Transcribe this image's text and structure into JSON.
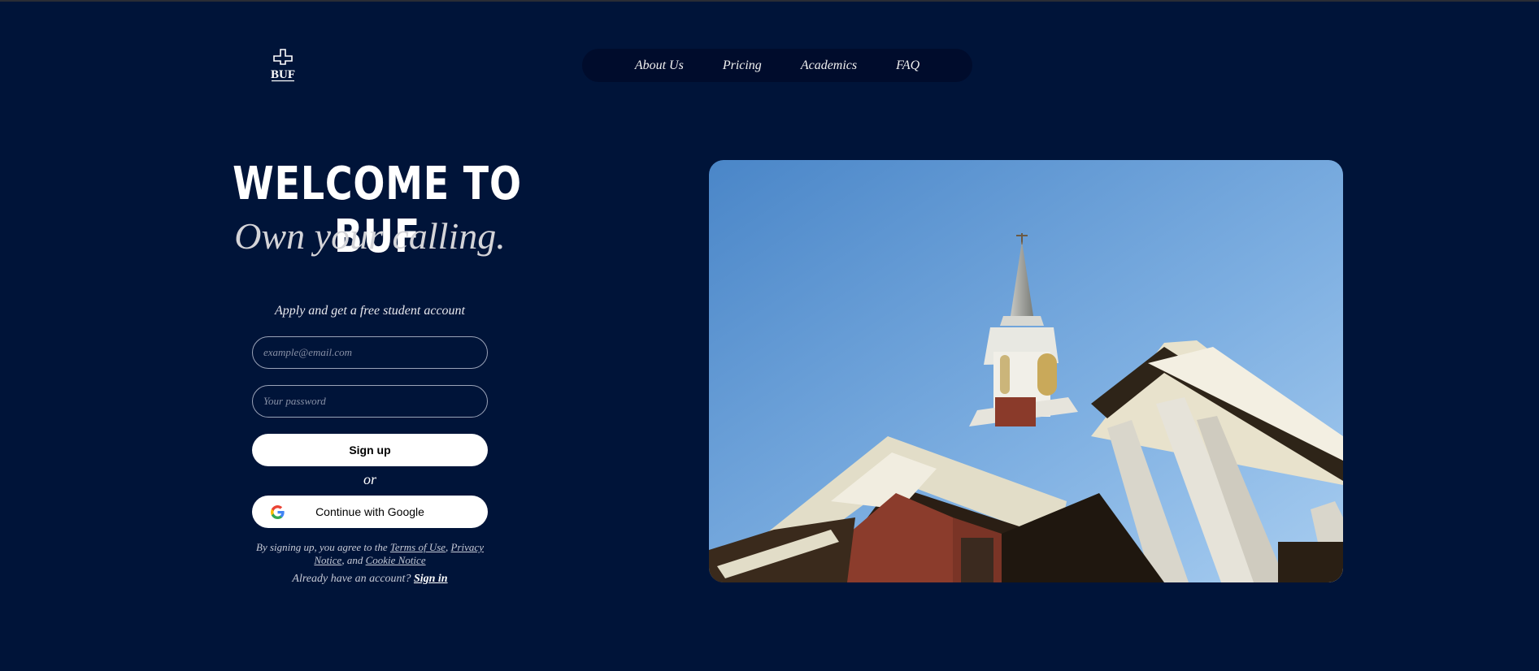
{
  "logo": {
    "text": "BUF",
    "icon": "cross-logo-icon"
  },
  "nav": {
    "items": [
      {
        "label": "About Us"
      },
      {
        "label": "Pricing"
      },
      {
        "label": "Academics"
      },
      {
        "label": "FAQ"
      }
    ]
  },
  "hero": {
    "title": "WELCOME TO BUF",
    "subtitle": "Own your calling."
  },
  "form": {
    "caption": "Apply and get a free student account",
    "email_placeholder": "example@email.com",
    "password_placeholder": "Your password",
    "signup_label": "Sign up",
    "or_label": "or",
    "google_label": "Continue with Google",
    "google_icon": "google-icon"
  },
  "terms": {
    "prefix": "By signing up, you agree to the ",
    "terms_link": "Terms of Use",
    "comma": ", ",
    "privacy_link": "Privacy Notice",
    "and": ", and ",
    "cookie_link": "Cookie Notice"
  },
  "signin": {
    "prefix": "Already have an account? ",
    "link": "Sign in"
  },
  "colors": {
    "background": "#001439",
    "nav_background": "#000c2c",
    "button_background": "#ffffff"
  }
}
